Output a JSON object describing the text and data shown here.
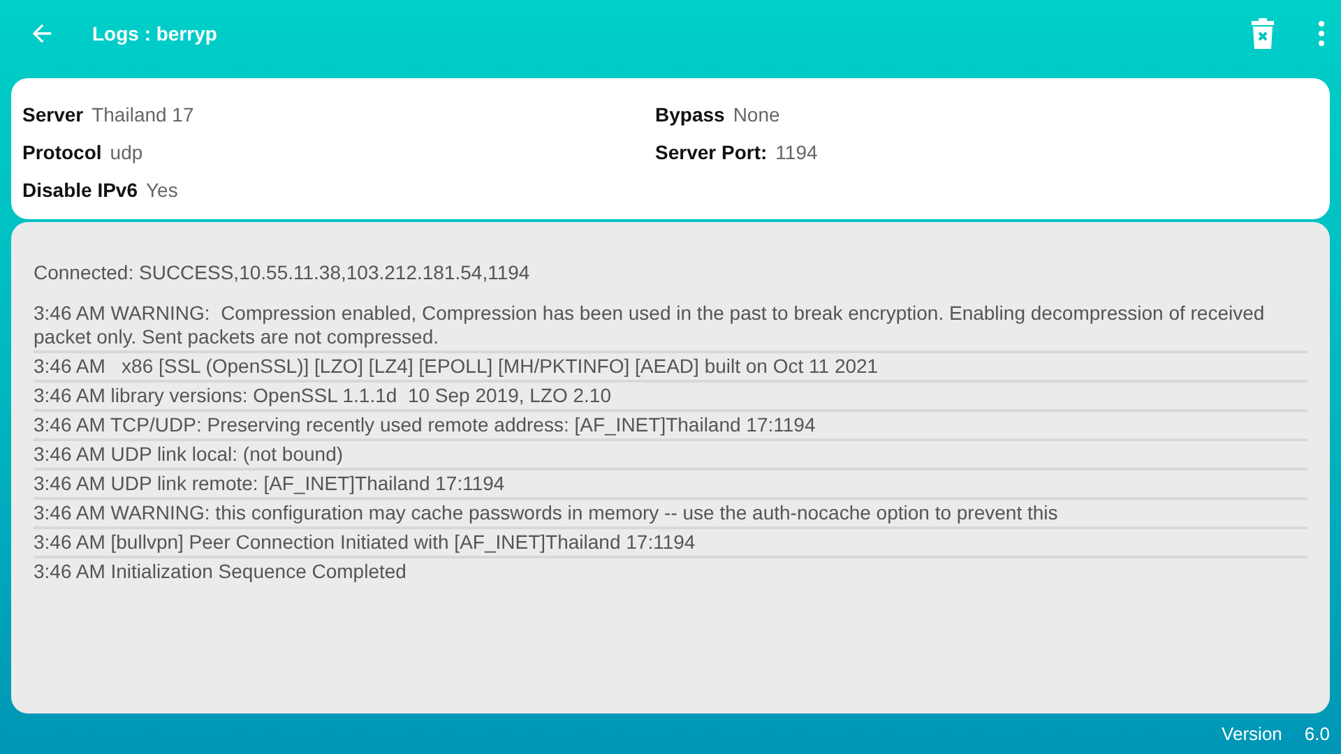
{
  "app_bar": {
    "title": "Logs : berryp"
  },
  "info": {
    "left": [
      {
        "label": "Server",
        "value": "Thailand 17"
      },
      {
        "label": "Protocol",
        "value": "udp"
      },
      {
        "label": "Disable IPv6",
        "value": "Yes"
      }
    ],
    "right": [
      {
        "label": "Bypass",
        "value": "None"
      },
      {
        "label": "Server Port:",
        "value": "1194"
      }
    ]
  },
  "status": "Connected: SUCCESS,10.55.11.38,103.212.181.54,1194",
  "log": [
    "3:46 AM WARNING:  Compression enabled, Compression has been used in the past to break encryption. Enabling decompression of received packet only. Sent packets are not compressed.",
    "3:46 AM   x86 [SSL (OpenSSL)] [LZO] [LZ4] [EPOLL] [MH/PKTINFO] [AEAD] built on Oct 11 2021",
    "3:46 AM library versions: OpenSSL 1.1.1d  10 Sep 2019, LZO 2.10",
    "3:46 AM TCP/UDP: Preserving recently used remote address: [AF_INET]Thailand 17:1194",
    "3:46 AM UDP link local: (not bound)",
    "3:46 AM UDP link remote: [AF_INET]Thailand 17:1194",
    "3:46 AM WARNING: this configuration may cache passwords in memory -- use the auth-nocache option to prevent this",
    "3:46 AM [bullvpn] Peer Connection Initiated with [AF_INET]Thailand 17:1194",
    "3:46 AM Initialization Sequence Completed"
  ],
  "footer": {
    "label": "Version",
    "value": "6.0"
  }
}
